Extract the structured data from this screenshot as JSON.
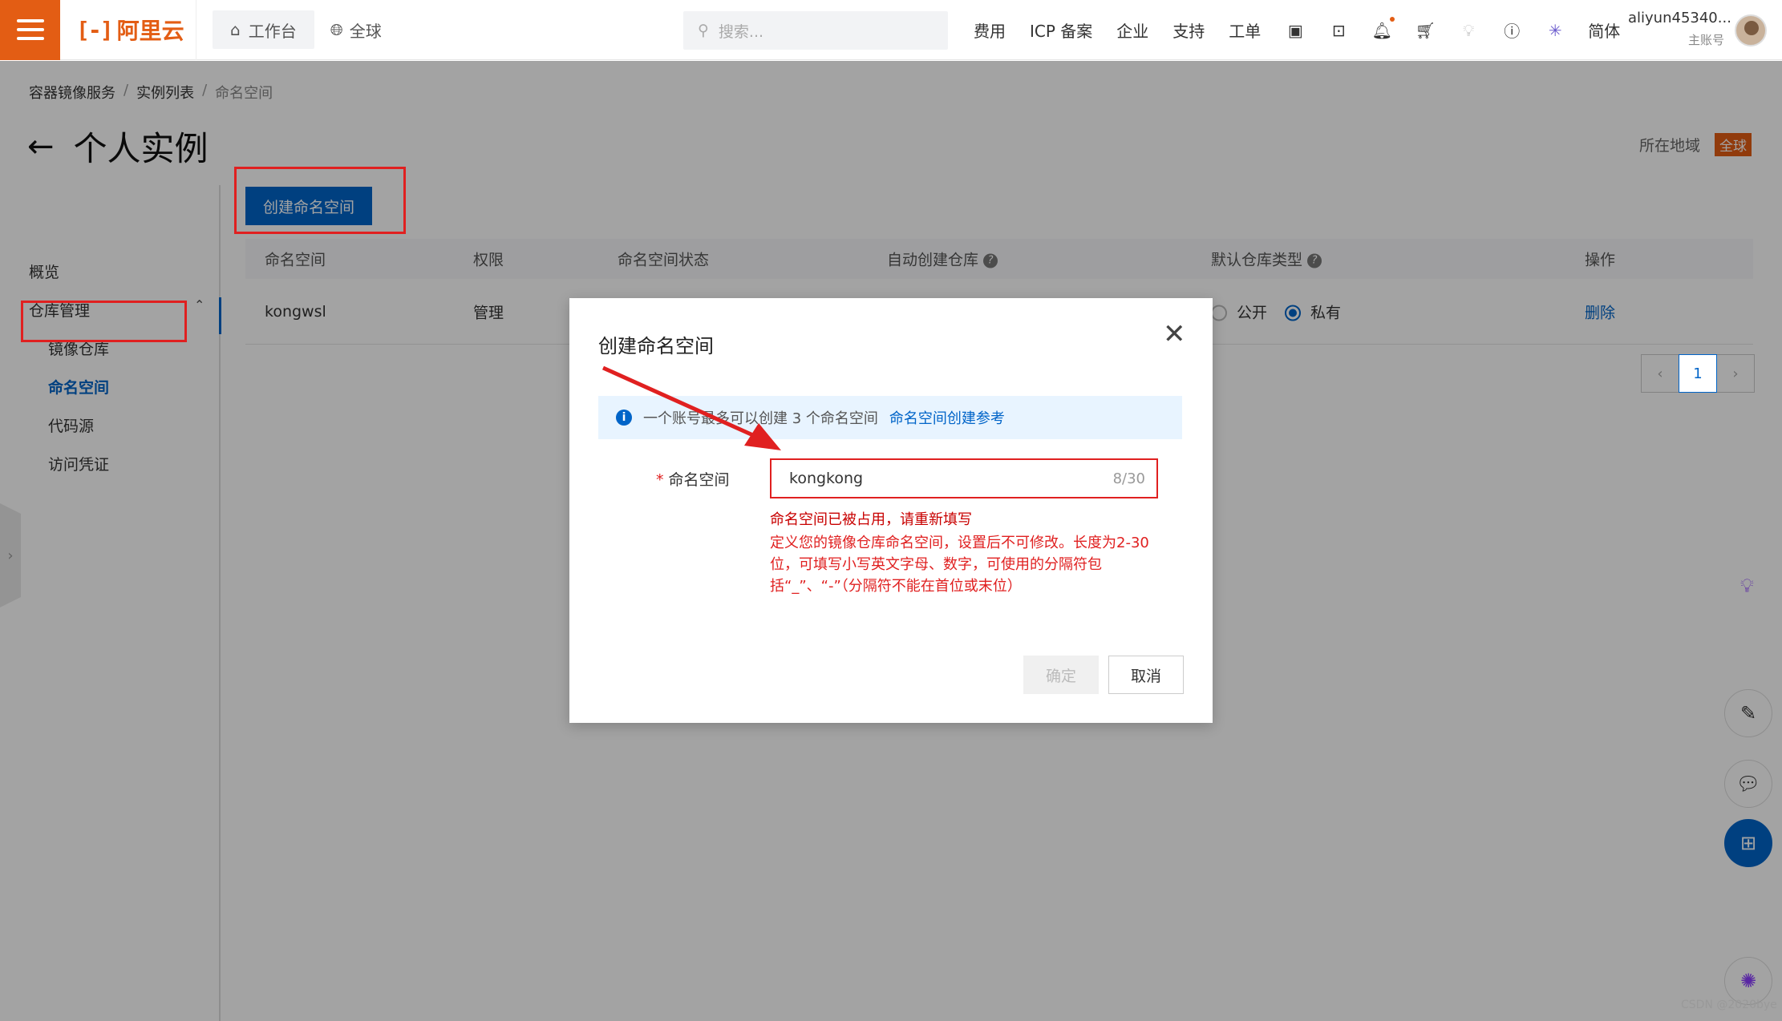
{
  "topbar": {
    "brand": "阿里云",
    "workbench": "工作台",
    "global": "全球",
    "search_placeholder": "搜索...",
    "links": [
      "费用",
      "ICP 备案",
      "企业",
      "支持",
      "工单"
    ],
    "lang": "简体",
    "user_name": "aliyun45340...",
    "user_role": "主账号",
    "accent": "#e35d14"
  },
  "breadcrumb": [
    "容器镜像服务",
    "实例列表",
    "命名空间"
  ],
  "page": {
    "title": "个人实例",
    "region_label": "所在地域",
    "region_value": "全球"
  },
  "sidebar": {
    "overview": "概览",
    "group": "仓库管理",
    "items": [
      "镜像仓库",
      "命名空间",
      "代码源",
      "访问凭证"
    ],
    "active": "命名空间"
  },
  "toolbar": {
    "create_label": "创建命名空间"
  },
  "table": {
    "columns": [
      "命名空间",
      "权限",
      "命名空间状态",
      "自动创建仓库",
      "默认仓库类型",
      "操作"
    ],
    "rows": [
      {
        "name": "kongwsl",
        "permission": "管理",
        "type_public": "公开",
        "type_private": "私有",
        "action": "删除"
      }
    ]
  },
  "pagination": {
    "current": "1"
  },
  "modal": {
    "title": "创建命名空间",
    "notice_text": "一个账号最多可以创建 3 个命名空间",
    "notice_link": "命名空间创建参考",
    "field_label": "命名空间",
    "field_value": "kongkong",
    "field_count": "8/30",
    "error_main": "命名空间已被占用，请重新填写",
    "error_help": "定义您的镜像仓库命名空间，设置后不可修改。长度为2-30位，可填写小写英文字母、数字，可使用的分隔符包括“_”、“-”（分隔符不能在首位或末位）",
    "ok_label": "确定",
    "cancel_label": "取消"
  },
  "watermark": "CSDN @2020bye"
}
